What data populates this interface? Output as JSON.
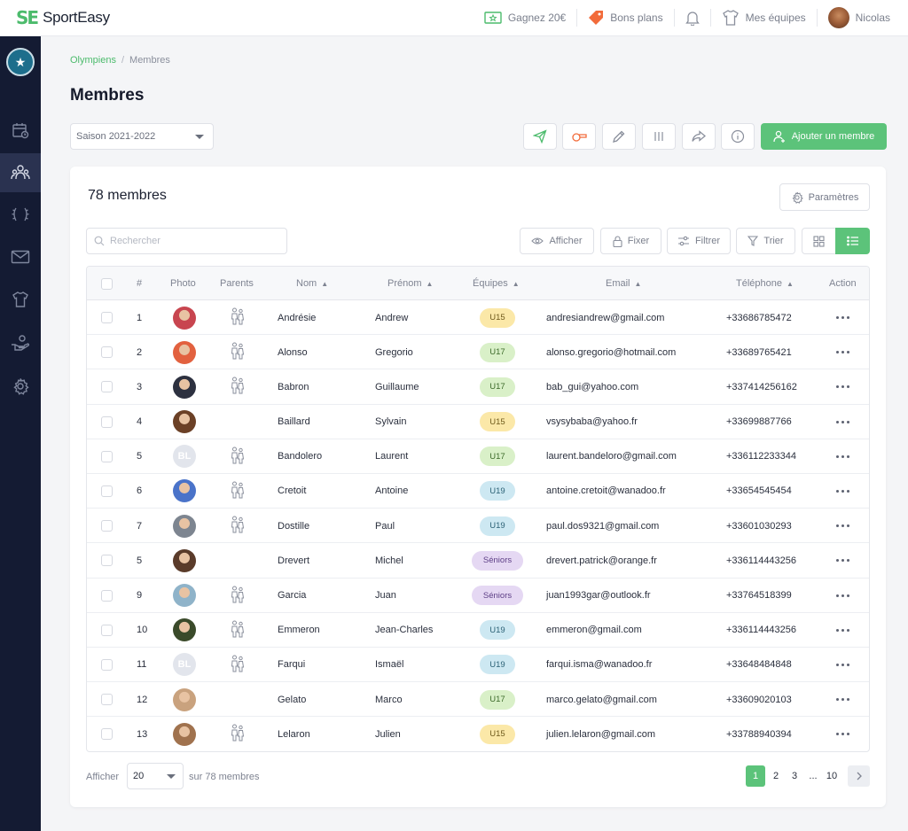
{
  "app": {
    "logo_mark": "SE",
    "name": "SportEasy"
  },
  "topbar": {
    "gift_label": "Gagnez 20€",
    "deals_label": "Bons plans",
    "teams_label": "Mes équipes",
    "user_name": "Nicolas",
    "colors": {
      "accent": "#4cbb6c",
      "deals": "#f26b3a"
    }
  },
  "sidebar": {
    "items": [
      {
        "icon": "calendar-icon",
        "active": false
      },
      {
        "icon": "members-icon",
        "active": true
      },
      {
        "icon": "laurel-icon",
        "active": false
      },
      {
        "icon": "mail-icon",
        "active": false
      },
      {
        "icon": "jersey-icon",
        "active": false
      },
      {
        "icon": "hand-coin-icon",
        "active": false
      },
      {
        "icon": "gear-icon",
        "active": false
      }
    ]
  },
  "breadcrumb": {
    "parent": "Olympiens",
    "separator": "/",
    "current": "Membres"
  },
  "page": {
    "title": "Membres"
  },
  "season": {
    "value": "Saison 2021-2022"
  },
  "toolbar": {
    "icons": [
      "send-icon",
      "whistle-icon",
      "pencil-icon",
      "columns-icon",
      "share-icon",
      "info-icon"
    ],
    "add_label": "Ajouter un membre"
  },
  "card": {
    "count_label": "78 membres",
    "params_label": "Paramètres",
    "search_placeholder": "Rechercher",
    "filters": {
      "show": "Afficher",
      "pin": "Fixer",
      "filter": "Filtrer",
      "sort": "Trier"
    }
  },
  "table": {
    "headers": {
      "num": "#",
      "photo": "Photo",
      "parents": "Parents",
      "nom": "Nom",
      "prenom": "Prénom",
      "equipes": "Équipes",
      "email": "Email",
      "telephone": "Téléphone",
      "action": "Action"
    },
    "rows": [
      {
        "num": "1",
        "photo": "#c8454f",
        "initials": "",
        "parents": true,
        "nom": "Andrésie",
        "prenom": "Andrew",
        "team": "U15",
        "team_class": "U15",
        "email": "andresiandrew@gmail.com",
        "phone": "+33686785472"
      },
      {
        "num": "2",
        "photo": "#e2613f",
        "initials": "",
        "parents": true,
        "nom": "Alonso",
        "prenom": "Gregorio",
        "team": "U17",
        "team_class": "U17",
        "email": "alonso.gregorio@hotmail.com",
        "phone": "+33689765421"
      },
      {
        "num": "3",
        "photo": "#2d3140",
        "initials": "",
        "parents": true,
        "nom": "Babron",
        "prenom": "Guillaume",
        "team": "U17",
        "team_class": "U17",
        "email": "bab_gui@yahoo.com",
        "phone": "+337414256162"
      },
      {
        "num": "4",
        "photo": "#6b4026",
        "initials": "",
        "parents": false,
        "nom": "Baillard",
        "prenom": "Sylvain",
        "team": "U15",
        "team_class": "U15",
        "email": "vsysybaba@yahoo.fr",
        "phone": "+33699887766"
      },
      {
        "num": "5",
        "photo": "",
        "initials": "BL",
        "parents": true,
        "nom": "Bandolero",
        "prenom": "Laurent",
        "team": "U17",
        "team_class": "U17",
        "email": "laurent.bandeloro@gmail.com",
        "phone": "+336112233344"
      },
      {
        "num": "6",
        "photo": "#4a73c9",
        "initials": "",
        "parents": true,
        "nom": "Cretoit",
        "prenom": "Antoine",
        "team": "U19",
        "team_class": "U19",
        "email": "antoine.cretoit@wanadoo.fr",
        "phone": "+33654545454"
      },
      {
        "num": "7",
        "photo": "#7d8590",
        "initials": "",
        "parents": true,
        "nom": "Dostille",
        "prenom": "Paul",
        "team": "U19",
        "team_class": "U19",
        "email": "paul.dos9321@gmail.com",
        "phone": "+33601030293"
      },
      {
        "num": "5",
        "photo": "#5a3b2a",
        "initials": "",
        "parents": false,
        "nom": "Drevert",
        "prenom": "Michel",
        "team": "Séniors",
        "team_class": "Seniors",
        "email": "drevert.patrick@orange.fr",
        "phone": "+336114443256"
      },
      {
        "num": "9",
        "photo": "#8fb3c9",
        "initials": "",
        "parents": true,
        "nom": "Garcia",
        "prenom": "Juan",
        "team": "Séniors",
        "team_class": "Seniors",
        "email": "juan1993gar@outlook.fr",
        "phone": "+33764518399"
      },
      {
        "num": "10",
        "photo": "#3a4a2a",
        "initials": "",
        "parents": true,
        "nom": "Emmeron",
        "prenom": "Jean-Charles",
        "team": "U19",
        "team_class": "U19",
        "email": "emmeron@gmail.com",
        "phone": "+336114443256"
      },
      {
        "num": "11",
        "photo": "",
        "initials": "BL",
        "parents": true,
        "nom": "Farqui",
        "prenom": "Ismaël",
        "team": "U19",
        "team_class": "U19",
        "email": "farqui.isma@wanadoo.fr",
        "phone": "+33648484848"
      },
      {
        "num": "12",
        "photo": "#c9a27e",
        "initials": "",
        "parents": false,
        "nom": "Gelato",
        "prenom": "Marco",
        "team": "U17",
        "team_class": "U17",
        "email": "marco.gelato@gmail.com",
        "phone": "+33609020103"
      },
      {
        "num": "13",
        "photo": "#a0724e",
        "initials": "",
        "parents": true,
        "nom": "Lelaron",
        "prenom": "Julien",
        "team": "U15",
        "team_class": "U15",
        "email": "julien.lelaron@gmail.com",
        "phone": "+33788940394"
      }
    ]
  },
  "footer": {
    "show_label": "Afficher",
    "per_page": "20",
    "total_label": "sur 78 membres",
    "pages": [
      "1",
      "2",
      "3",
      "...",
      "10"
    ],
    "current_page": "1"
  }
}
